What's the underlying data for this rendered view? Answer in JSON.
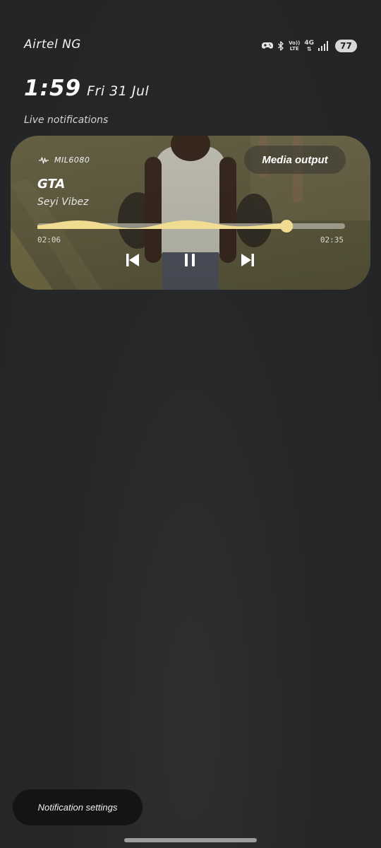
{
  "status_bar": {
    "carrier": "Airtel NG",
    "volte_top": "Vo))",
    "volte_bottom": "LTE",
    "network": "4G",
    "battery": "77",
    "icons": [
      "gamepad-icon",
      "bluetooth-icon",
      "volte-icon",
      "network-4g-icon",
      "signal-icon",
      "battery-icon"
    ]
  },
  "header": {
    "time": "1:59",
    "date": "Fri 31 Jul",
    "section_label": "Live notifications"
  },
  "media": {
    "source_icon": "waveform-icon",
    "source": "MIL6080",
    "output_button": "Media output",
    "title": "GTA",
    "artist": "Seyi Vibez",
    "elapsed": "02:06",
    "duration": "02:35",
    "progress": 0.81,
    "accent_color": "#f1dd91",
    "controls": [
      "previous-icon",
      "pause-icon",
      "next-icon"
    ]
  },
  "footer": {
    "notification_settings": "Notification settings"
  }
}
